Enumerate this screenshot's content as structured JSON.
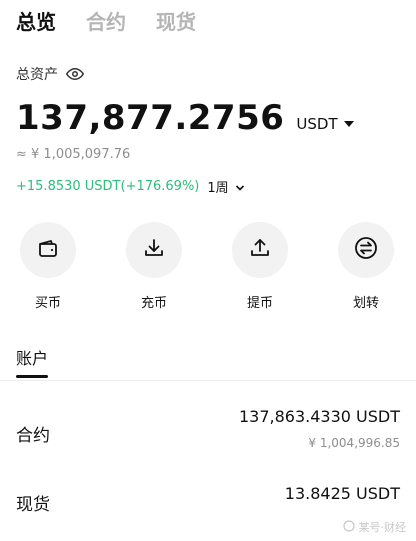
{
  "tabs": [
    {
      "label": "总览",
      "active": true
    },
    {
      "label": "合约",
      "active": false
    },
    {
      "label": "现货",
      "active": false
    }
  ],
  "assets": {
    "label": "总资产",
    "value": "137,877.2756",
    "currency": "USDT",
    "fiat": "≈ ¥ 1,005,097.76",
    "pnl": "+15.8530 USDT(+176.69%)",
    "period": "1周"
  },
  "actions": [
    {
      "label": "买币",
      "icon": "wallet-icon"
    },
    {
      "label": "充币",
      "icon": "deposit-icon"
    },
    {
      "label": "提币",
      "icon": "withdraw-icon"
    },
    {
      "label": "划转",
      "icon": "transfer-icon"
    }
  ],
  "section": {
    "title": "账户"
  },
  "accounts": [
    {
      "name": "合约",
      "amount": "137,863.4330 USDT",
      "fiat": "¥ 1,004,996.85"
    },
    {
      "name": "现货",
      "amount": "13.8425 USDT"
    }
  ],
  "watermark": "某号·财经",
  "colors": {
    "positive": "#2dbc7d",
    "muted": "#8e8e8e",
    "icon_bg": "#f2f2f2"
  }
}
